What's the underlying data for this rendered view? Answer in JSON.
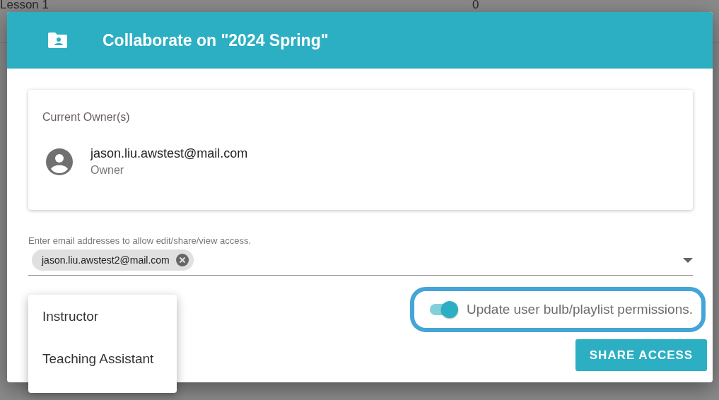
{
  "background_table": {
    "rows": [
      {
        "cells": [
          "Lesson 1",
          "0"
        ]
      }
    ]
  },
  "dialog": {
    "title": "Collaborate on \"2024 Spring\"",
    "owners": {
      "heading": "Current Owner(s)",
      "items": [
        {
          "email": "jason.liu.awstest@mail.com",
          "role": "Owner"
        }
      ]
    },
    "email_field": {
      "label": "Enter email addresses to allow edit/share/view access.",
      "chips": [
        "jason.liu.awstest2@mail.com"
      ]
    },
    "permission_toggle": {
      "label": "Update user bulb/playlist permissions.",
      "on": true
    },
    "share_button": "SHARE ACCESS"
  },
  "role_menu": {
    "items": [
      {
        "label": "Instructor"
      },
      {
        "label": "Teaching Assistant"
      }
    ]
  }
}
